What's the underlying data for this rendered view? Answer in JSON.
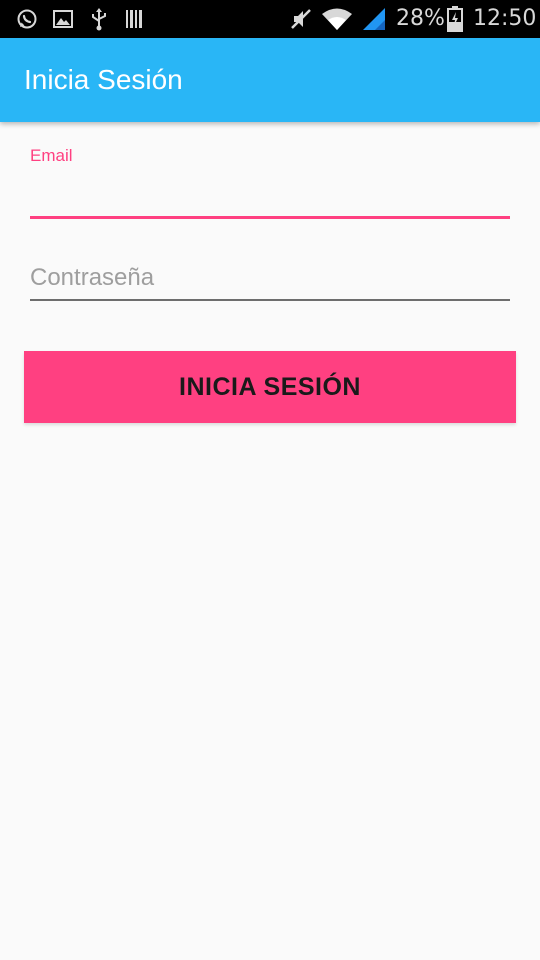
{
  "status_bar": {
    "battery_percent": "28%",
    "time": "12:50",
    "icons": [
      "whatsapp-icon",
      "image-icon",
      "usb-icon",
      "barcode-icon",
      "mute-icon",
      "wifi-icon",
      "signal-icon",
      "battery-charging-icon"
    ]
  },
  "app_bar": {
    "title": "Inicia Sesión",
    "color": "#29b6f6"
  },
  "form": {
    "email_label": "Email",
    "email_value": "",
    "password_placeholder": "Contraseña",
    "password_value": "",
    "submit_label": "INICIA SESIÓN",
    "accent_color": "#ff4081"
  }
}
